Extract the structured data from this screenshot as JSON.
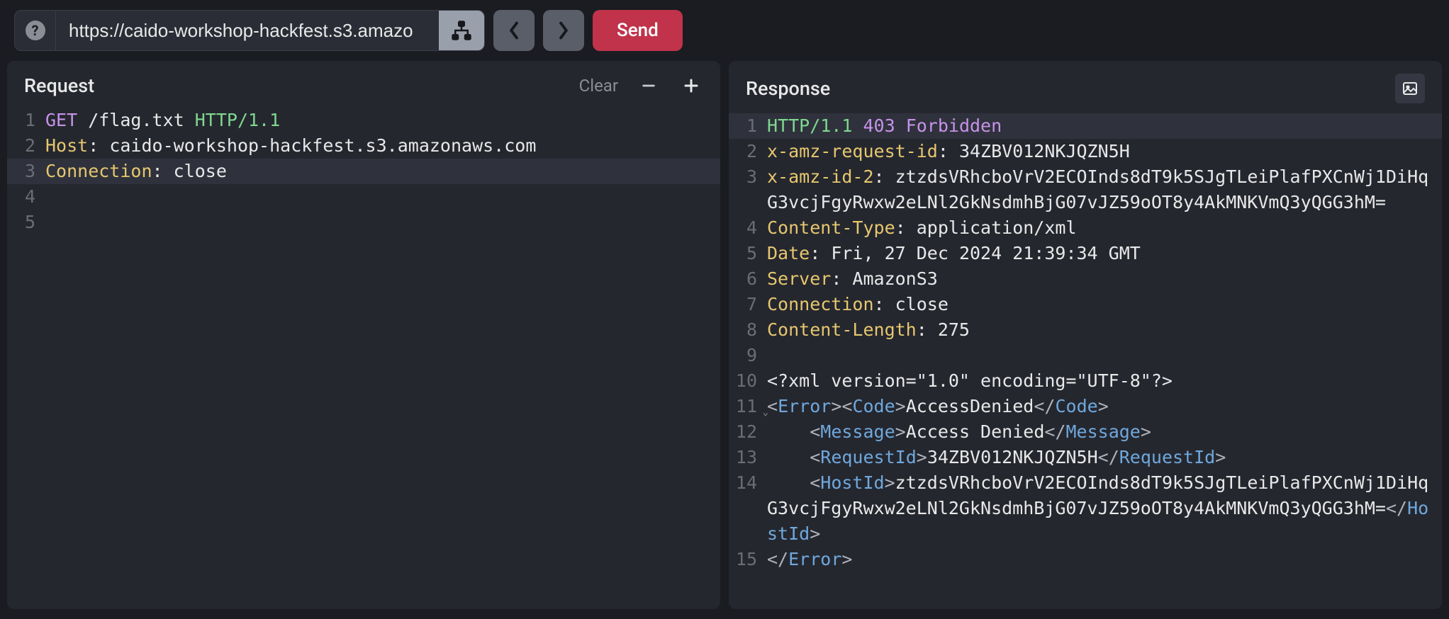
{
  "toolbar": {
    "url": "https://caido-workshop-hackfest.s3.amazo",
    "send_label": "Send"
  },
  "request_panel": {
    "title": "Request",
    "clear_label": "Clear",
    "lines": [
      {
        "n": "1",
        "hl": false,
        "segs": [
          {
            "cls": "tk-method",
            "t": "GET"
          },
          {
            "cls": "tk-plain",
            "t": " /flag.txt "
          },
          {
            "cls": "tk-proto",
            "t": "HTTP/1.1"
          }
        ]
      },
      {
        "n": "2",
        "hl": false,
        "segs": [
          {
            "cls": "tk-header",
            "t": "Host"
          },
          {
            "cls": "tk-punc",
            "t": ": "
          },
          {
            "cls": "tk-plain",
            "t": "caido-workshop-hackfest.s3.amazonaws.com"
          }
        ]
      },
      {
        "n": "3",
        "hl": true,
        "segs": [
          {
            "cls": "tk-header",
            "t": "Connection"
          },
          {
            "cls": "tk-punc",
            "t": ": "
          },
          {
            "cls": "tk-plain",
            "t": "close"
          }
        ]
      },
      {
        "n": "4",
        "hl": false,
        "segs": []
      },
      {
        "n": "5",
        "hl": false,
        "segs": []
      }
    ]
  },
  "response_panel": {
    "title": "Response",
    "lines": [
      {
        "n": "1",
        "hl": true,
        "segs": [
          {
            "cls": "tk-proto",
            "t": "HTTP/1.1"
          },
          {
            "cls": "tk-plain",
            "t": " "
          },
          {
            "cls": "tk-status",
            "t": "403"
          },
          {
            "cls": "tk-plain",
            "t": " "
          },
          {
            "cls": "tk-reason",
            "t": "Forbidden"
          }
        ]
      },
      {
        "n": "2",
        "segs": [
          {
            "cls": "tk-header",
            "t": "x-amz-request-id"
          },
          {
            "cls": "tk-punc",
            "t": ": "
          },
          {
            "cls": "tk-plain",
            "t": "34ZBV012NKJQZN5H"
          }
        ]
      },
      {
        "n": "3",
        "segs": [
          {
            "cls": "tk-header",
            "t": "x-amz-id-2"
          },
          {
            "cls": "tk-punc",
            "t": ": "
          },
          {
            "cls": "tk-plain",
            "t": "ztzdsVRhcboVrV2ECOInds8dT9k5SJgTLeiPlafPXCnWj1DiHqG3vcjFgyRwxw2eLNl2GkNsdmhBjG07vJZ59oOT8y4AkMNKVmQ3yQGG3hM="
          }
        ]
      },
      {
        "n": "4",
        "segs": [
          {
            "cls": "tk-header",
            "t": "Content-Type"
          },
          {
            "cls": "tk-punc",
            "t": ": "
          },
          {
            "cls": "tk-plain",
            "t": "application/xml"
          }
        ]
      },
      {
        "n": "5",
        "segs": [
          {
            "cls": "tk-header",
            "t": "Date"
          },
          {
            "cls": "tk-punc",
            "t": ": "
          },
          {
            "cls": "tk-plain",
            "t": "Fri, 27 Dec 2024 21:39:34 GMT"
          }
        ]
      },
      {
        "n": "6",
        "segs": [
          {
            "cls": "tk-header",
            "t": "Server"
          },
          {
            "cls": "tk-punc",
            "t": ": "
          },
          {
            "cls": "tk-plain",
            "t": "AmazonS3"
          }
        ]
      },
      {
        "n": "7",
        "segs": [
          {
            "cls": "tk-header",
            "t": "Connection"
          },
          {
            "cls": "tk-punc",
            "t": ": "
          },
          {
            "cls": "tk-plain",
            "t": "close"
          }
        ]
      },
      {
        "n": "8",
        "segs": [
          {
            "cls": "tk-header",
            "t": "Content-Length"
          },
          {
            "cls": "tk-punc",
            "t": ": "
          },
          {
            "cls": "tk-plain",
            "t": "275"
          }
        ]
      },
      {
        "n": "9",
        "segs": []
      },
      {
        "n": "10",
        "segs": [
          {
            "cls": "tk-xmlpl",
            "t": "<?xml version=\"1.0\" encoding=\"UTF-8\"?>"
          }
        ]
      },
      {
        "n": "11",
        "fold": true,
        "segs": [
          {
            "cls": "tk-brk",
            "t": "<"
          },
          {
            "cls": "tk-tag",
            "t": "Error"
          },
          {
            "cls": "tk-brk",
            "t": ">"
          },
          {
            "cls": "tk-brk",
            "t": "<"
          },
          {
            "cls": "tk-tag",
            "t": "Code"
          },
          {
            "cls": "tk-brk",
            "t": ">"
          },
          {
            "cls": "tk-plain",
            "t": "AccessDenied"
          },
          {
            "cls": "tk-brk",
            "t": "</"
          },
          {
            "cls": "tk-tag",
            "t": "Code"
          },
          {
            "cls": "tk-brk",
            "t": ">"
          }
        ]
      },
      {
        "n": "12",
        "indent": 1,
        "segs": [
          {
            "cls": "tk-brk",
            "t": "<"
          },
          {
            "cls": "tk-tag",
            "t": "Message"
          },
          {
            "cls": "tk-brk",
            "t": ">"
          },
          {
            "cls": "tk-plain",
            "t": "Access Denied"
          },
          {
            "cls": "tk-brk",
            "t": "</"
          },
          {
            "cls": "tk-tag",
            "t": "Message"
          },
          {
            "cls": "tk-brk",
            "t": ">"
          }
        ]
      },
      {
        "n": "13",
        "indent": 1,
        "segs": [
          {
            "cls": "tk-brk",
            "t": "<"
          },
          {
            "cls": "tk-tag",
            "t": "RequestId"
          },
          {
            "cls": "tk-brk",
            "t": ">"
          },
          {
            "cls": "tk-plain",
            "t": "34ZBV012NKJQZN5H"
          },
          {
            "cls": "tk-brk",
            "t": "</"
          },
          {
            "cls": "tk-tag",
            "t": "RequestId"
          },
          {
            "cls": "tk-brk",
            "t": ">"
          }
        ]
      },
      {
        "n": "14",
        "indent": 1,
        "segs": [
          {
            "cls": "tk-brk",
            "t": "<"
          },
          {
            "cls": "tk-tag",
            "t": "HostId"
          },
          {
            "cls": "tk-brk",
            "t": ">"
          },
          {
            "cls": "tk-plain",
            "t": "ztzdsVRhcboVrV2ECOInds8dT9k5SJgTLeiPlafPXCnWj1DiHqG3vcjFgyRwxw2eLNl2GkNsdmhBjG07vJZ59oOT8y4AkMNKVmQ3yQGG3hM="
          },
          {
            "cls": "tk-brk",
            "t": "</"
          },
          {
            "cls": "tk-tag",
            "t": "HostId"
          },
          {
            "cls": "tk-brk",
            "t": ">"
          }
        ]
      },
      {
        "n": "15",
        "segs": [
          {
            "cls": "tk-brk",
            "t": "</"
          },
          {
            "cls": "tk-tag",
            "t": "Error"
          },
          {
            "cls": "tk-brk",
            "t": ">"
          }
        ]
      }
    ]
  }
}
